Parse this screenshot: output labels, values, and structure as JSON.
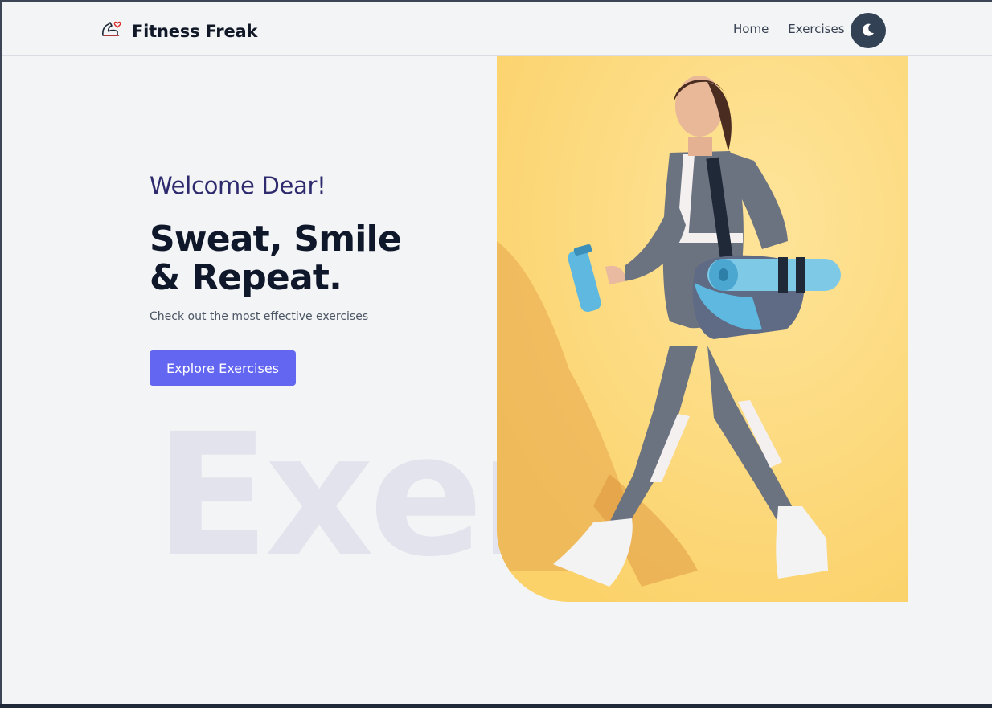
{
  "brand": {
    "name": "Fitness Freak",
    "logo_icon": "flexed-arm-heart-icon"
  },
  "nav": {
    "home": "Home",
    "exercises": "Exercises",
    "theme_icon": "moon-icon"
  },
  "hero": {
    "welcome": "Welcome Dear!",
    "headline_line1": "Sweat, Smile",
    "headline_line2": "& Repeat.",
    "subtitle": "Check out the most effective exercises",
    "cta_label": "Explore Exercises",
    "background_word": "Exercise"
  },
  "colors": {
    "accent": "#6366f1",
    "welcome_text": "#2e2a6e",
    "toggle_bg": "#334155",
    "image_bg": "#fdd97a"
  }
}
